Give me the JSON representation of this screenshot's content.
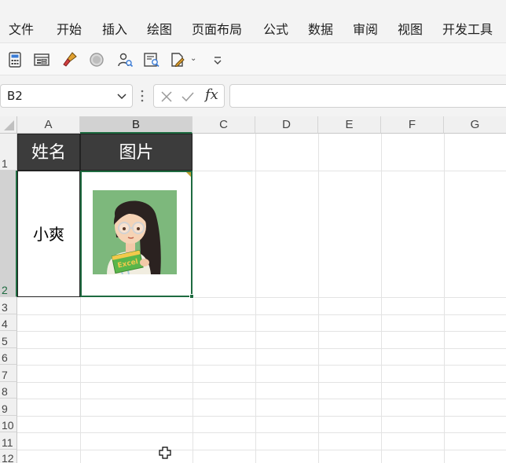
{
  "menu": [
    "文件",
    "开始",
    "插入",
    "绘图",
    "页面布局",
    "公式",
    "数据",
    "审阅",
    "视图",
    "开发工具"
  ],
  "toolbar": {
    "icons": [
      "calculator-icon",
      "form-icon",
      "format-painter-icon",
      "circle-icon",
      "user-search-icon",
      "report-icon",
      "edit-doc-icon",
      "customize-icon"
    ]
  },
  "formula_bar": {
    "name_box": "B2",
    "cancel_icon": "cancel-icon",
    "enter_icon": "check-icon",
    "fx_label": "fx",
    "formula": ""
  },
  "sheet": {
    "columns": [
      "A",
      "B",
      "C",
      "D",
      "E",
      "F",
      "G"
    ],
    "rows": [
      "1",
      "2",
      "3",
      "4",
      "5",
      "6",
      "7",
      "8",
      "9",
      "10",
      "11",
      "12"
    ],
    "selected_cell": "B2",
    "header_fill": "#3c3c3c",
    "selection_color": "#1e6b40",
    "cells": {
      "A1": "姓名",
      "B1": "图片",
      "A2": "小爽"
    },
    "picture": {
      "cell": "B2",
      "description_icon": "avatar-girl-icon",
      "book_text": "Excel"
    }
  }
}
